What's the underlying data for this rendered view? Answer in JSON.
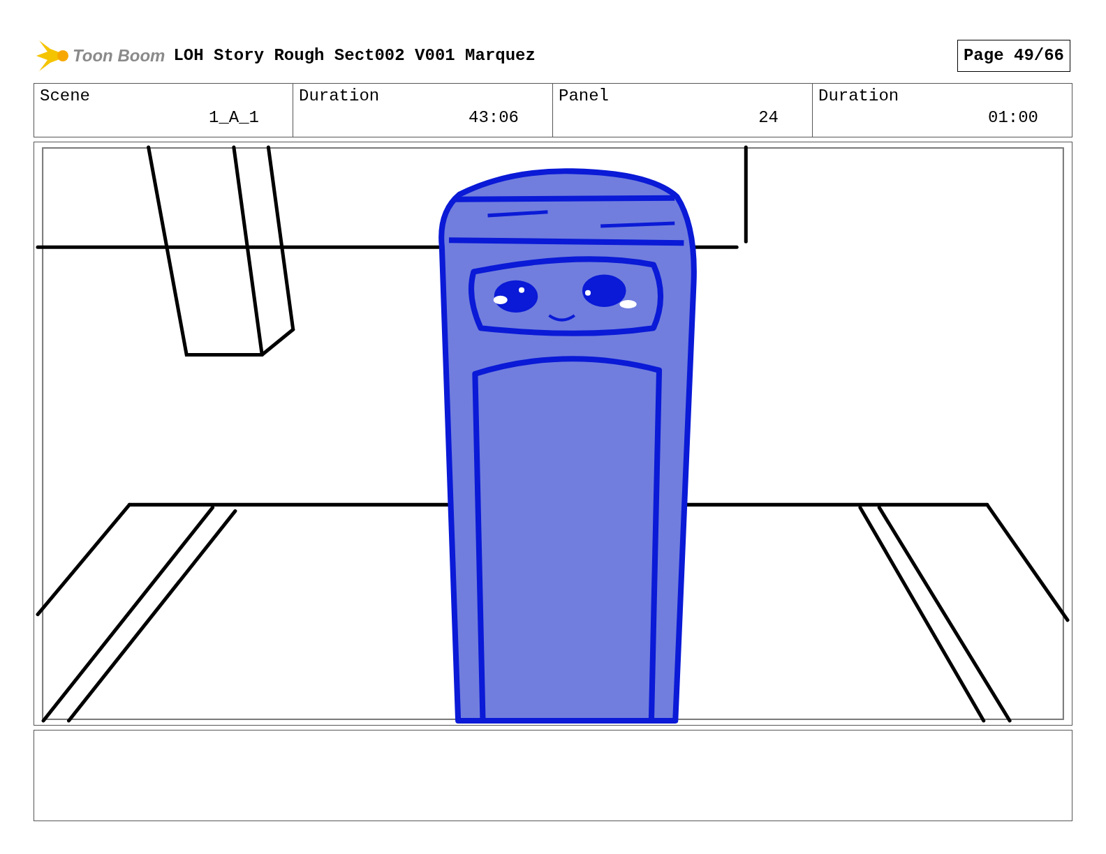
{
  "header": {
    "logo": "Toon Boom",
    "title": "LOH Story Rough Sect002 V001 Marquez",
    "page": "Page 49/66"
  },
  "fields": [
    {
      "label": "Scene",
      "value": "1_A_1"
    },
    {
      "label": "Duration",
      "value": "43:06"
    },
    {
      "label": "Panel",
      "value": "24"
    },
    {
      "label": "Duration",
      "value": "01:00"
    }
  ]
}
